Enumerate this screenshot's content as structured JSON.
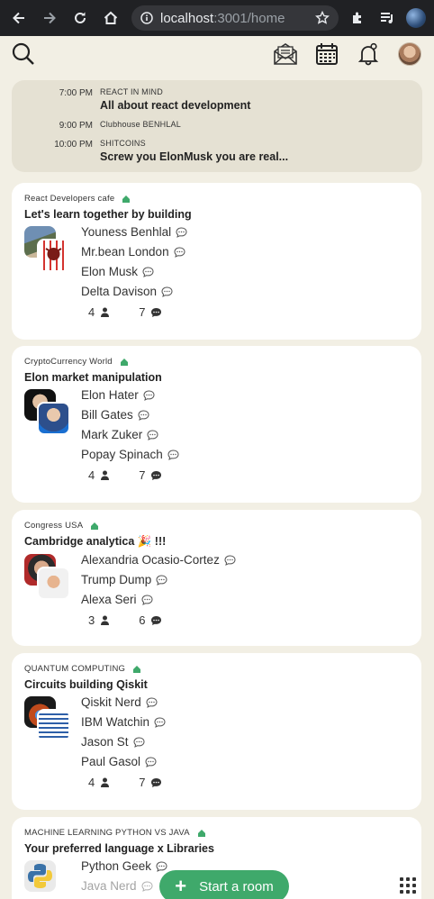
{
  "browser": {
    "url_host": "localhost",
    "url_path": ":3001/home"
  },
  "schedule": [
    {
      "time": "7:00 PM",
      "club": "REACT IN MIND",
      "title": "All about react development"
    },
    {
      "time": "9:00 PM",
      "club": "Clubhouse BENHLAL",
      "title": ""
    },
    {
      "time": "10:00 PM",
      "club": "SHITCOINS",
      "title": "Screw you ElonMusk you are real..."
    }
  ],
  "rooms": [
    {
      "club": "React Developers cafe",
      "title": "Let's learn together by building",
      "speakers": [
        "Youness Benhlal",
        "Mr.bean London",
        "Elon Musk",
        "Delta Davison"
      ],
      "listeners": "4",
      "messages": "7"
    },
    {
      "club": "CryptoCurrency World",
      "title": "Elon market manipulation",
      "speakers": [
        "Elon Hater",
        "Bill Gates",
        "Mark Zuker",
        "Popay Spinach"
      ],
      "listeners": "4",
      "messages": "7"
    },
    {
      "club": "Congress USA",
      "title": "Cambridge analytica 🎉 !!!",
      "speakers": [
        "Alexandria Ocasio-Cortez",
        "Trump Dump",
        "Alexa Seri"
      ],
      "listeners": "3",
      "messages": "6"
    },
    {
      "club": "QUANTUM COMPUTING",
      "title": "Circuits building Qiskit",
      "speakers": [
        "Qiskit Nerd",
        "IBM Watchin",
        "Jason St",
        "Paul Gasol"
      ],
      "listeners": "4",
      "messages": "7"
    },
    {
      "club": "MACHINE LEARNING PYTHON VS JAVA",
      "title": "Your preferred language x Libraries",
      "speakers": [
        "Python Geek",
        "Java Nerd"
      ],
      "listeners": "",
      "messages": ""
    }
  ],
  "start_room_label": "Start a room",
  "colors": {
    "accent": "#3fa96b",
    "background": "#f2efe4"
  },
  "icons": [
    "search-icon",
    "envelope-icon",
    "calendar-icon",
    "bell-icon",
    "house-icon",
    "chat-icon",
    "person-icon",
    "grid-icon"
  ]
}
